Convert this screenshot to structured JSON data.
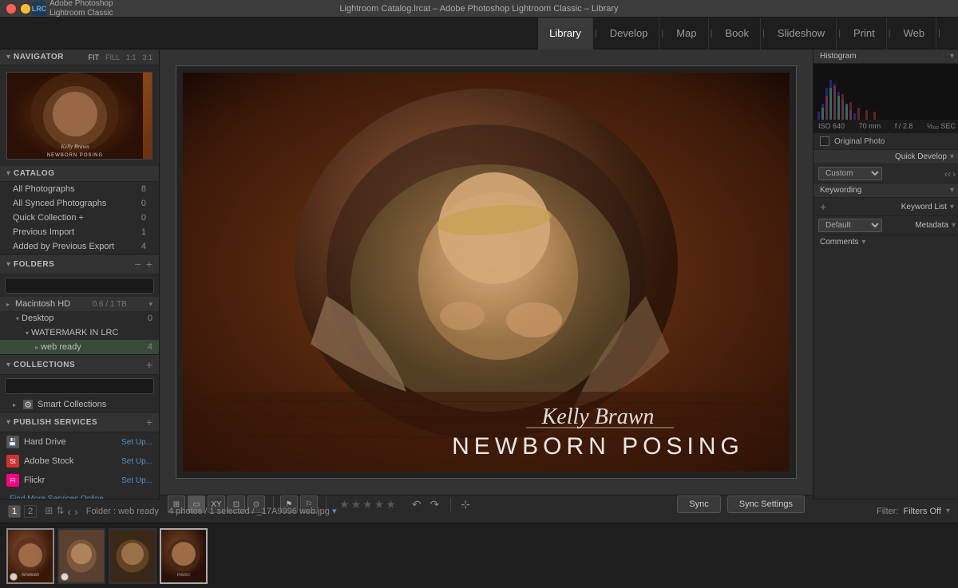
{
  "titlebar": {
    "title": "Lightroom Catalog.lrcat – Adobe Photoshop Lightroom Classic – Library",
    "app_name": "Adobe Photoshop",
    "app_sub": "Lightroom Classic",
    "logo_letters": "LRC"
  },
  "topnav": {
    "items": [
      {
        "label": "Library",
        "active": true
      },
      {
        "label": "Develop",
        "active": false
      },
      {
        "label": "Map",
        "active": false
      },
      {
        "label": "Book",
        "active": false
      },
      {
        "label": "Slideshow",
        "active": false
      },
      {
        "label": "Print",
        "active": false
      },
      {
        "label": "Web",
        "active": false
      }
    ]
  },
  "navigator": {
    "title": "Navigator",
    "controls": [
      "FIT",
      "FILL",
      "1:1",
      "3:1"
    ]
  },
  "catalog": {
    "title": "Catalog",
    "items": [
      {
        "name": "All Photographs",
        "count": "8"
      },
      {
        "name": "All Synced Photographs",
        "count": "0"
      },
      {
        "name": "Quick Collection +",
        "count": "0"
      },
      {
        "name": "Previous Import",
        "count": "1"
      },
      {
        "name": "Added by Previous Export",
        "count": "4"
      }
    ]
  },
  "folders": {
    "title": "Folders",
    "drive": {
      "name": "Macintosh HD",
      "space": "0.6 / 1 TB"
    },
    "items": [
      {
        "name": "Desktop",
        "indent": 1,
        "count": "0"
      },
      {
        "name": "WATERMARK IN LRC",
        "indent": 2,
        "count": ""
      },
      {
        "name": "web ready",
        "indent": 3,
        "count": "4"
      }
    ]
  },
  "collections": {
    "title": "Collections",
    "items": [
      {
        "name": "Smart Collections"
      }
    ]
  },
  "publish_services": {
    "title": "Publish Services",
    "items": [
      {
        "name": "Hard Drive",
        "icon": "HD",
        "setup": "Set Up..."
      },
      {
        "name": "Adobe Stock",
        "icon": "St",
        "setup": "Set Up..."
      },
      {
        "name": "Flickr",
        "icon": "Fl",
        "setup": "Set Up..."
      }
    ],
    "find_more": "Find More Services Online..."
  },
  "photo": {
    "watermark_script": "Kelly Brawn",
    "watermark_caps": "NEWBORN POSING"
  },
  "histogram": {
    "title": "Histogram",
    "stats": {
      "iso": "ISO 640",
      "focal": "70 mm",
      "exposure": "f / 2.8",
      "speed": "½₀₀ SEC"
    }
  },
  "right_panel": {
    "original_photo_label": "Original Photo",
    "quick_develop": {
      "label": "Quick Develop",
      "preset": "Custom"
    },
    "keywording": {
      "label": "Keywording"
    },
    "keyword_list": {
      "label": "Keyword List"
    },
    "metadata": {
      "label": "Metadata",
      "preset": "Default"
    },
    "comments": {
      "label": "Comments"
    }
  },
  "toolbar": {
    "sync_label": "Sync",
    "sync_settings_label": "Sync Settings"
  },
  "statusbar": {
    "page1": "1",
    "page2": "2",
    "folder_info": "Folder : web ready",
    "photo_info": "4 photos / 1 selected / _17A9996 web.jpg",
    "filter_label": "Filter:",
    "filter_value": "Filters Off"
  },
  "filmstrip": {
    "thumbs": [
      {
        "bg": "#6b3010",
        "active": true,
        "badge": "white"
      },
      {
        "bg": "#9a8070",
        "active": false,
        "badge": "white"
      },
      {
        "bg": "#4a3020",
        "active": false,
        "badge": ""
      },
      {
        "bg": "#7a5030",
        "active": false,
        "badge": ""
      }
    ]
  }
}
